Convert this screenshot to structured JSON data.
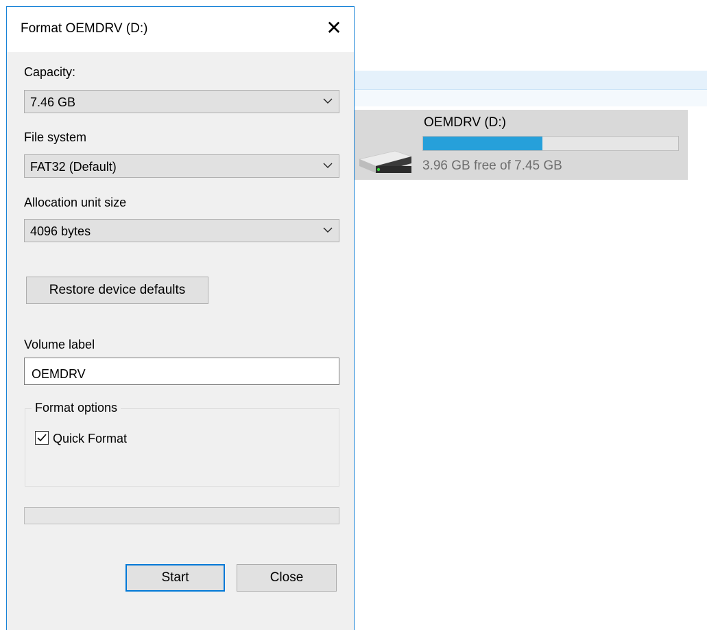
{
  "dialog": {
    "title": "Format OEMDRV (D:)",
    "close_glyph": "✕",
    "capacity": {
      "label": "Capacity:",
      "value": "7.46 GB"
    },
    "file_system": {
      "label": "File system",
      "value": "FAT32 (Default)"
    },
    "allocation": {
      "label": "Allocation unit size",
      "value": "4096 bytes"
    },
    "restore_label": "Restore device defaults",
    "volume": {
      "label": "Volume label",
      "value": "OEMDRV"
    },
    "format_options": {
      "legend": "Format options",
      "quick_format_label": "Quick Format",
      "quick_format_checked": true
    },
    "progress_fraction": 0,
    "start_label": "Start",
    "close_label": "Close"
  },
  "drive": {
    "name": "OEMDRV (D:)",
    "free_text": "3.96 GB free of 7.45 GB",
    "used_fraction": 0.469,
    "bar_color": "#26a0da",
    "icon": "usb-drive-icon"
  },
  "colors": {
    "accent": "#0078d7",
    "dialog_border": "#1883d7",
    "dialog_bg": "#f0f0f0"
  }
}
